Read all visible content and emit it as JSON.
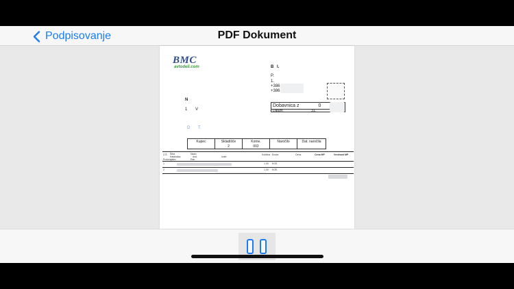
{
  "nav": {
    "back_label": "Podpisovanje",
    "title": "PDF Dokument"
  },
  "document": {
    "logo": {
      "main": "BMC",
      "sub": "avtodeli.com"
    },
    "recipient": {
      "initial": "B",
      "initial_rest": "I.",
      "line1": "P.",
      "line2": "1.",
      "phone1": "+386",
      "phone2": "+386"
    },
    "left": {
      "n": "N",
      "line": "1",
      "line_b": "V",
      "contact": "D",
      "contact_b": "T."
    },
    "delivery": {
      "label": "Dobavnica z",
      "label_value": "0",
      "date_label": "Datum",
      "date_value": "31."
    },
    "header_table": [
      {
        "head": "Kupec",
        "value": ""
      },
      {
        "head": "Skladišče",
        "value": "2"
      },
      {
        "head": "Kome.",
        "value": "002"
      },
      {
        "head": "Naročilo",
        "value": ""
      },
      {
        "head": "Dat. naročila",
        "value": ""
      }
    ],
    "columns": {
      "num": "Z.Š.",
      "sifra": "Šifra",
      "kataloska": "Kataloška",
      "naziv": "Naziv",
      "naziv2": "dod.",
      "proizvajalec": "Proizvajalec",
      "ean": "Ean",
      "kolicina": "Količina",
      "enota": "Enota",
      "cena": "Cena",
      "cena_mp": "Cena MP",
      "vrednost_mp": "Vrednost MP"
    },
    "rows": [
      {
        "num": "1",
        "qty": "1,00",
        "unit": "KOS"
      },
      {
        "num": "2",
        "qty": "1,00",
        "unit": "KOS"
      }
    ]
  }
}
